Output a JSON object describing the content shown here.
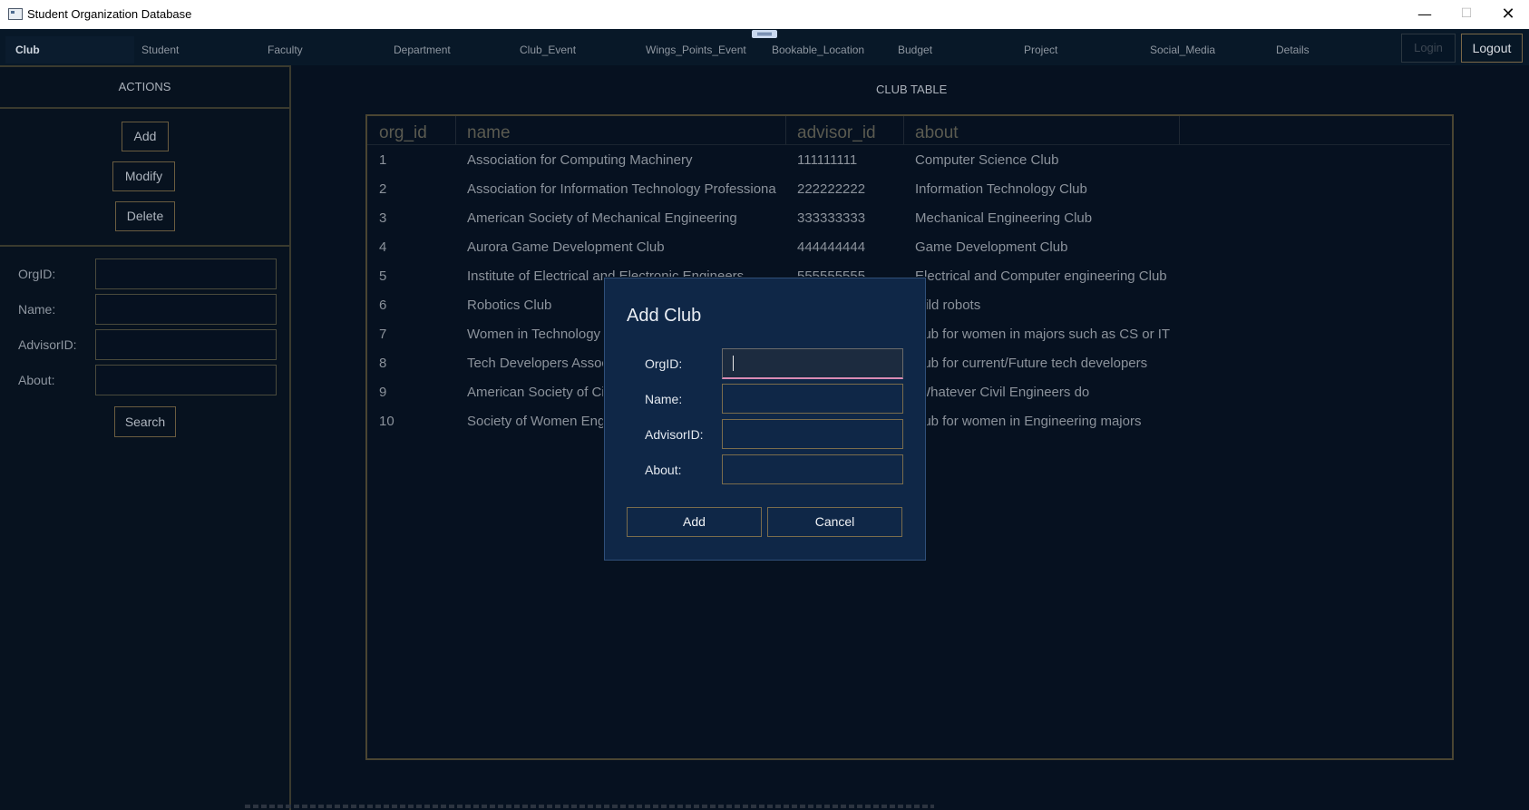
{
  "window": {
    "title": "Student Organization Database",
    "controls": {
      "minimize": "—",
      "maximize": "☐",
      "close": "✕"
    }
  },
  "tabs": [
    {
      "label": "Club",
      "active": true
    },
    {
      "label": "Student"
    },
    {
      "label": "Faculty"
    },
    {
      "label": "Department"
    },
    {
      "label": "Club_Event"
    },
    {
      "label": "Wings_Points_Event"
    },
    {
      "label": "Bookable_Location"
    },
    {
      "label": "Budget"
    },
    {
      "label": "Project"
    },
    {
      "label": "Social_Media"
    },
    {
      "label": "Details"
    }
  ],
  "auth": {
    "login": "Login",
    "logout": "Logout"
  },
  "sidebar": {
    "header": "ACTIONS",
    "actions": {
      "add": "Add",
      "modify": "Modify",
      "delete": "Delete"
    },
    "fields": [
      {
        "label": "OrgID:",
        "value": ""
      },
      {
        "label": "Name:",
        "value": ""
      },
      {
        "label": "AdvisorID:",
        "value": ""
      },
      {
        "label": "About:",
        "value": ""
      }
    ],
    "search": "Search"
  },
  "table": {
    "title": "CLUB TABLE",
    "columns": [
      "org_id",
      "name",
      "advisor_id",
      "about"
    ],
    "rows": [
      [
        "1",
        "Association for Computing Machinery",
        "111111111",
        "Computer Science Club"
      ],
      [
        "2",
        "Association for Information Technology Professiona",
        "222222222",
        "Information Technology Club"
      ],
      [
        "3",
        "American Society of Mechanical Engineering",
        "333333333",
        "Mechanical Engineering Club"
      ],
      [
        "4",
        "Aurora Game Development Club",
        "444444444",
        "Game Development Club"
      ],
      [
        "5",
        "Institute of Electrical and Electronic Engineers",
        "555555555",
        "Electrical and Computer engineering Club"
      ],
      [
        "6",
        "Robotics Club",
        "",
        "uild robots"
      ],
      [
        "7",
        "Women in Technology",
        "",
        "lub for women in majors such as CS or IT"
      ],
      [
        "8",
        "Tech Developers Assoc",
        "",
        "lub for current/Future tech developers"
      ],
      [
        "9",
        "American Society of Civ",
        "",
        "Whatever Civil Engineers do"
      ],
      [
        "10",
        "Society of Women Eng",
        "",
        "lub for women in Engineering majors"
      ]
    ]
  },
  "dialog": {
    "title": "Add Club",
    "fields": [
      {
        "label": "OrgID:",
        "value": ""
      },
      {
        "label": "Name:",
        "value": ""
      },
      {
        "label": "AdvisorID:",
        "value": ""
      },
      {
        "label": "About:",
        "value": ""
      }
    ],
    "add": "Add",
    "cancel": "Cancel"
  }
}
